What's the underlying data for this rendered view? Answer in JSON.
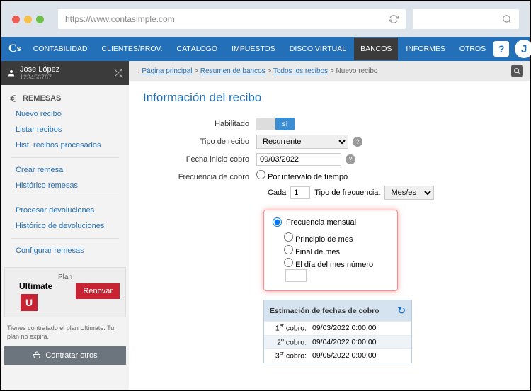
{
  "browser": {
    "url": "https://www.contasimple.com"
  },
  "nav": {
    "items": [
      "CONTABILIDAD",
      "CLIENTES/PROV.",
      "CATÁLOGO",
      "IMPUESTOS",
      "DISCO VIRTUAL",
      "BANCOS",
      "INFORMES",
      "OTROS"
    ],
    "avatar_initial": "J"
  },
  "user": {
    "name": "Jose López",
    "id": "123456787"
  },
  "sidebar": {
    "header": "REMESAS",
    "links": [
      "Nuevo recibo",
      "Listar recibos",
      "Hist. recibos procesados",
      "Crear remesa",
      "Histórico remesas",
      "Procesar devoluciones",
      "Histórico de devoluciones",
      "Configurar remesas"
    ]
  },
  "plan": {
    "label": "Plan",
    "name": "Ultimate",
    "badge": "U",
    "renew": "Renovar",
    "desc": "Tienes contratado el plan Ultimate. Tu plan no expira.",
    "contract": "Contratar otros"
  },
  "breadcrumb": {
    "prefix": ":: ",
    "parts": [
      "Página principal",
      "Resumen de bancos",
      "Todos los recibos"
    ],
    "current": "Nuevo recibo"
  },
  "form": {
    "title": "Información del recibo",
    "enabled_label": "Habilitado",
    "enabled_value": "sí",
    "type_label": "Tipo de recibo",
    "type_value": "Recurrente",
    "start_label": "Fecha inicio cobro",
    "start_value": "09/03/2022",
    "freq_label": "Frecuencia de cobro",
    "interval_option": "Por intervalo de tiempo",
    "each": "Cada",
    "each_value": "1",
    "freq_type_label": "Tipo de frecuencia:",
    "freq_type_value": "Mes/es",
    "monthly_option": "Frecuencia mensual",
    "month_start": "Principio de mes",
    "month_end": "Final de mes",
    "month_day": "El día del mes número"
  },
  "estimation": {
    "title": "Estimación de fechas de cobro",
    "rows": [
      {
        "ord": "1",
        "suf": "er",
        "label": "cobro:",
        "date": "09/03/2022 0:00:00"
      },
      {
        "ord": "2",
        "suf": "o",
        "label": "cobro:",
        "date": "09/04/2022 0:00:00"
      },
      {
        "ord": "3",
        "suf": "er",
        "label": "cobro:",
        "date": "09/05/2022 0:00:00"
      }
    ]
  }
}
